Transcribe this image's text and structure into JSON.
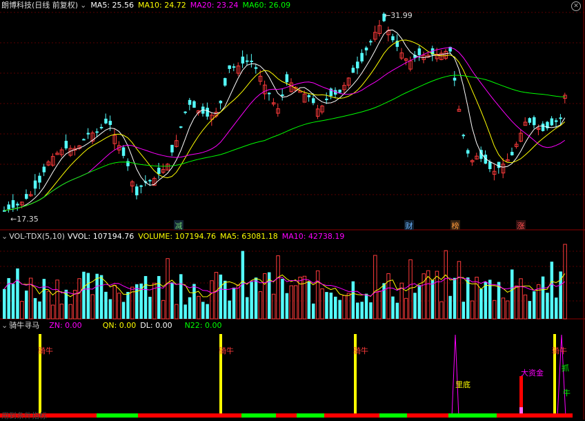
{
  "main_header": {
    "stock_name": "朗博科技",
    "period": "(日线 前复权)",
    "ma5_label": "MA5: 25.56",
    "ma10_label": "MA10: 24.72",
    "ma20_label": "MA20: 23.24",
    "ma60_label": "MA60: 26.09"
  },
  "price_labels": {
    "high": "31.99",
    "low": "17.35"
  },
  "event_markers": [
    {
      "text": "减",
      "color": "#6fcf6f"
    },
    {
      "text": "财",
      "color": "#6fb6ff"
    },
    {
      "text": "榜",
      "color": "#ff9a3c"
    },
    {
      "text": "涨",
      "color": "#ff5050"
    }
  ],
  "vol_header": {
    "indicator": "VOL-TDX(5,10)",
    "vvol": "VVOL: 107194.76",
    "volume": "VOLUME: 107194.76",
    "ma5": "MA5: 63081.18",
    "ma10": "MA10: 42738.19"
  },
  "ind_header": {
    "indicator": "骑牛寻马",
    "zn": "ZN: 0.00",
    "qn": "QN: 0.00",
    "dl": "DL: 0.00",
    "n22": "N22: 0.00"
  },
  "signals": {
    "qiniu": "骑牛",
    "lidi": "里底",
    "dazijin": "大资金",
    "zhua": "抓",
    "niu": "牛"
  },
  "footer_text": "用到条件指标",
  "colors": {
    "up": "#ff3b3b",
    "down": "#54fcfc",
    "ma5": "#ffffff",
    "ma10": "#ffff00",
    "ma20": "#ff00ff",
    "ma60": "#00ff00"
  }
}
